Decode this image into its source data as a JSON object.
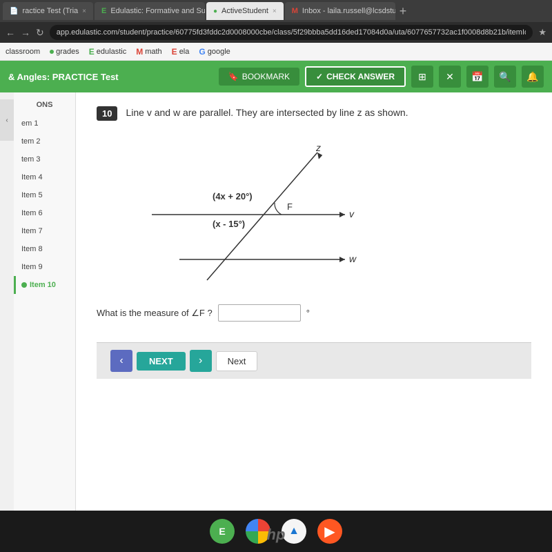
{
  "browser": {
    "tabs": [
      {
        "id": "tab1",
        "label": "ractice Test (Tria",
        "active": false,
        "favicon": "📄"
      },
      {
        "id": "tab2",
        "label": "Edulastic: Formative and Summ",
        "active": false,
        "favicon": "E"
      },
      {
        "id": "tab3",
        "label": "ActiveStudent",
        "active": true,
        "favicon": "●"
      },
      {
        "id": "tab4",
        "label": "Inbox - laila.russell@lcsdstudent",
        "active": false,
        "favicon": "M"
      }
    ],
    "address": "app.edulastic.com/student/practice/60775fd3fddc2d0008000cbe/class/5f29bbba5dd16ded17084d0a/uta/6077657732ac1f0008d8b21b/itemId/",
    "bookmarks": [
      {
        "label": "classroom",
        "dot": false
      },
      {
        "label": "grades",
        "dot": true,
        "dotColor": "green"
      },
      {
        "label": "edulastic",
        "favicon": "E"
      },
      {
        "label": "math",
        "favicon": "M"
      },
      {
        "label": "ela",
        "favicon": "E"
      },
      {
        "label": "google",
        "favicon": "G"
      }
    ]
  },
  "app": {
    "title": "& Angles: PRACTICE Test",
    "buttons": {
      "bookmark": "BOOKMARK",
      "check_answer": "CHECK ANSWER"
    },
    "icons": [
      "grid",
      "close",
      "calendar",
      "search",
      "bell"
    ]
  },
  "sidebar": {
    "header": "ONS",
    "items": [
      {
        "label": "em 1",
        "active": false
      },
      {
        "label": "tem 2",
        "active": false
      },
      {
        "label": "tem 3",
        "active": false
      },
      {
        "label": "Item 4",
        "active": false
      },
      {
        "label": "Item 5",
        "active": false
      },
      {
        "label": "Item 6",
        "active": false
      },
      {
        "label": "Item 7",
        "active": false
      },
      {
        "label": "Item 8",
        "active": false
      },
      {
        "label": "Item 9",
        "active": false
      },
      {
        "label": "Item 10",
        "active": true
      }
    ]
  },
  "question": {
    "number": "10",
    "text": "Line v and w are parallel. They are intersected by line z as shown.",
    "angle1_label": "(4x + 20°)",
    "angle2_label": "(x - 15°)",
    "point_label": "F",
    "line_v_label": "v",
    "line_w_label": "w",
    "line_z_label": "z",
    "answer_prompt": "What is the measure of ∠F ?",
    "answer_value": "",
    "degree_symbol": "°"
  },
  "navigation": {
    "prev_label": "‹",
    "next_label": "NEXT",
    "next_arrow": "›",
    "next_button": "Next"
  },
  "taskbar": {
    "icons": [
      {
        "name": "edulastic",
        "label": "E"
      },
      {
        "name": "chrome",
        "label": ""
      },
      {
        "name": "drive",
        "label": "▲"
      },
      {
        "name": "play",
        "label": "▶"
      }
    ]
  }
}
